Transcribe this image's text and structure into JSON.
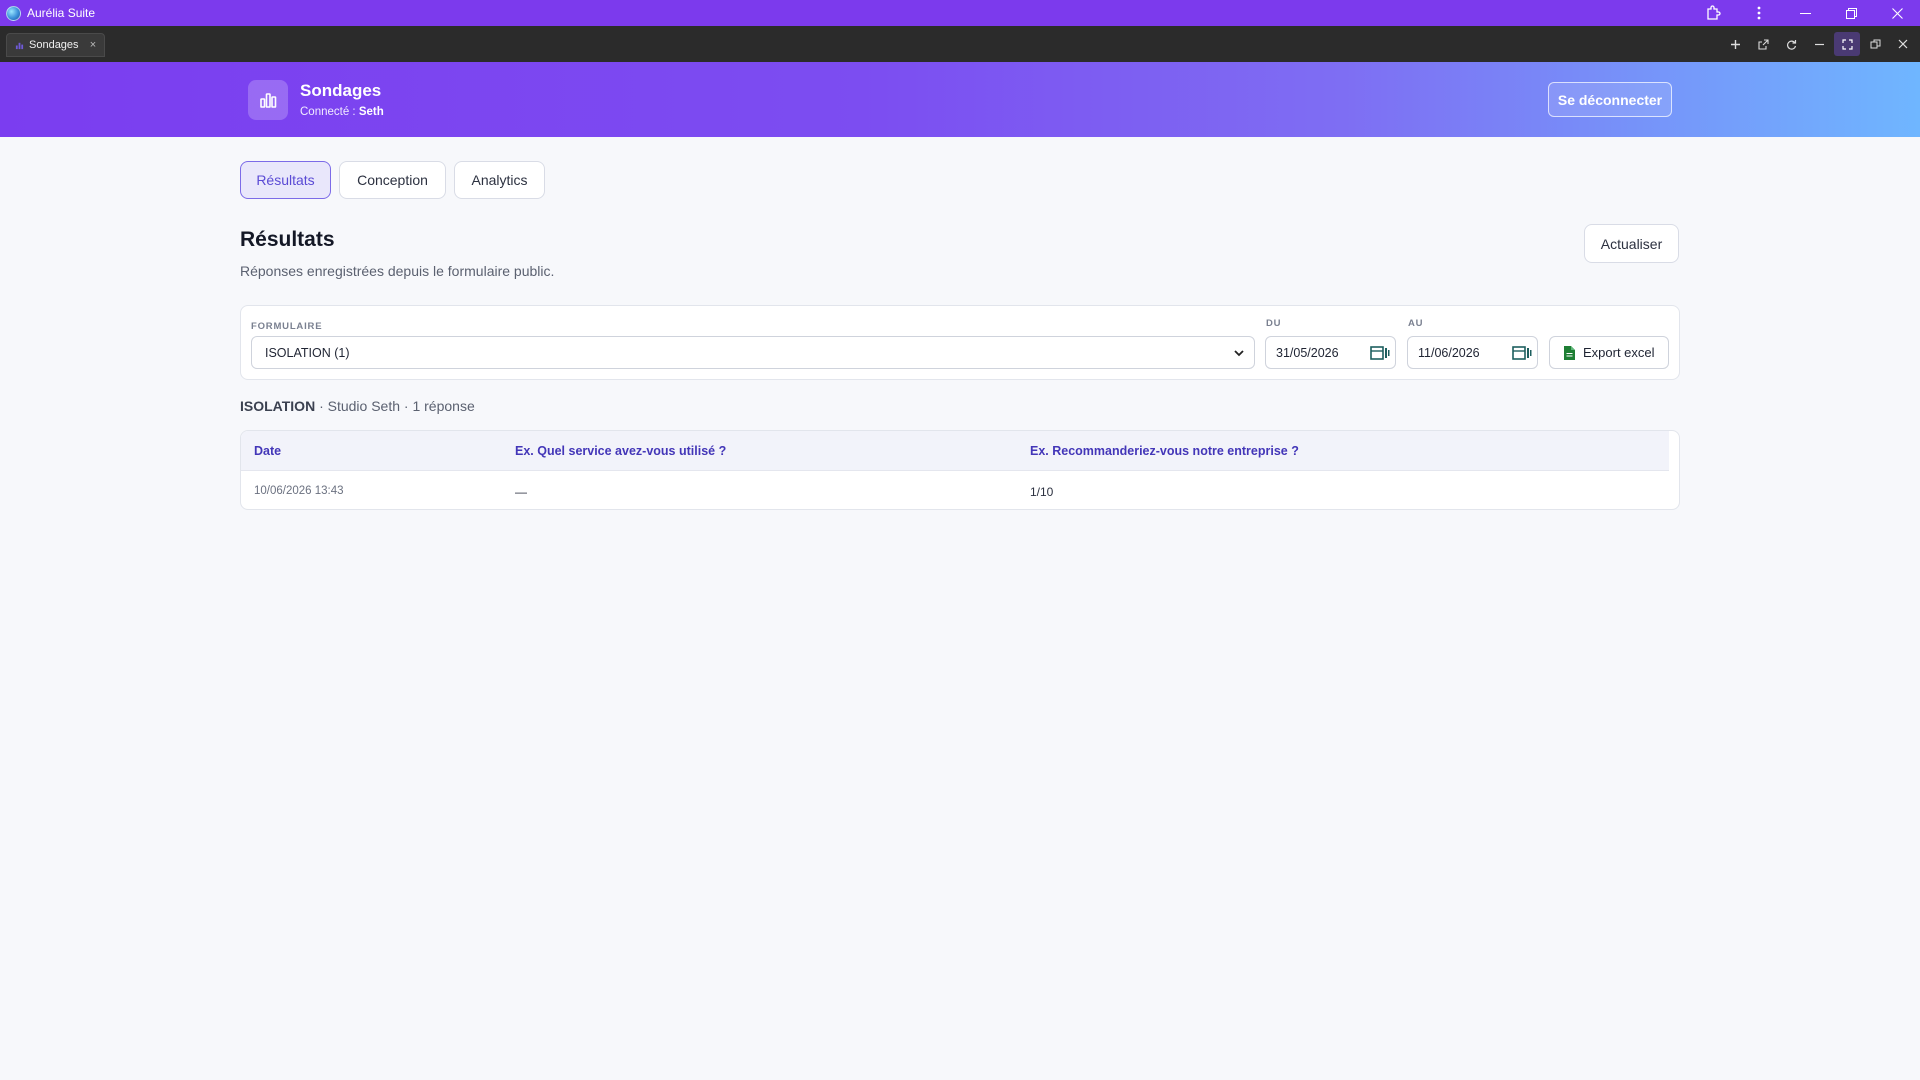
{
  "window": {
    "app_title": "Aurélia Suite"
  },
  "browser_tab": {
    "label": "Sondages",
    "close_glyph": "×"
  },
  "header": {
    "title": "Sondages",
    "connected_prefix": "Connecté : ",
    "connected_user": "Seth",
    "logout_label": "Se déconnecter"
  },
  "nav": {
    "tabs": [
      {
        "label": "Résultats",
        "active": true
      },
      {
        "label": "Conception",
        "active": false
      },
      {
        "label": "Analytics",
        "active": false
      }
    ]
  },
  "page": {
    "title": "Résultats",
    "subtitle": "Réponses enregistrées depuis le formulaire public.",
    "refresh_label": "Actualiser"
  },
  "filters": {
    "form_label": "FORMULAIRE",
    "form_value": "ISOLATION (1)",
    "from_label": "DU",
    "from_value": "31/05/2026",
    "to_label": "AU",
    "to_value": "11/06/2026",
    "export_label": "Export excel"
  },
  "summary": {
    "form_name": "ISOLATION",
    "rest": " · Studio Seth · 1 réponse"
  },
  "table": {
    "columns": [
      "Date",
      "Ex. Quel service avez-vous utilisé ?",
      "Ex. Recommanderiez-vous notre entreprise ?"
    ],
    "rows": [
      [
        "10/06/2026 13:43",
        "—",
        "1/10"
      ]
    ]
  },
  "colors": {
    "titlebar": "#7c3aed",
    "accent": "#5b4bd5",
    "header_gradient_start": "#7b3df0",
    "header_gradient_end": "#6fb6ff",
    "excel_green": "#1e7e34"
  }
}
